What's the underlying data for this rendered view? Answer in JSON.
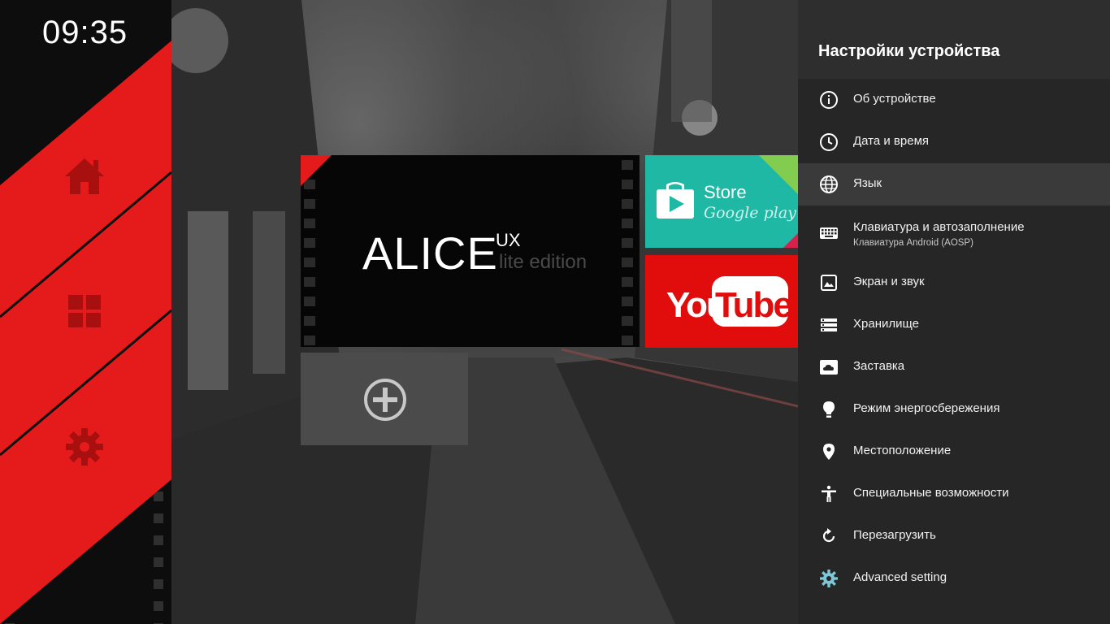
{
  "clock": "09:35",
  "sidebar": {
    "items": [
      {
        "name": "home-icon"
      },
      {
        "name": "apps-grid-icon"
      },
      {
        "name": "gear-icon"
      }
    ]
  },
  "tiles": {
    "alice": {
      "title": "ALICE",
      "superscript": "UX",
      "subtitle": "lite edition"
    },
    "store": {
      "title": "Store",
      "subtitle": "Google play"
    },
    "youtube": {
      "logo": "YouTube"
    },
    "add": {
      "icon": "plus-circle-icon"
    }
  },
  "settings": {
    "title": "Настройки устройства",
    "items": [
      {
        "label": "Об устройстве",
        "icon": "info-icon"
      },
      {
        "label": "Дата и время",
        "icon": "clock-icon"
      },
      {
        "label": "Язык",
        "icon": "globe-icon",
        "active": true
      },
      {
        "label": "Клавиатура и автозаполнение",
        "sublabel": "Клавиатура Android (AOSP)",
        "icon": "keyboard-icon"
      },
      {
        "label": "Экран и звук",
        "icon": "image-icon"
      },
      {
        "label": "Хранилище",
        "icon": "storage-icon"
      },
      {
        "label": "Заставка",
        "icon": "screensaver-icon"
      },
      {
        "label": "Режим энергосбережения",
        "icon": "lightbulb-icon"
      },
      {
        "label": "Местоположение",
        "icon": "location-icon"
      },
      {
        "label": "Специальные возможности",
        "icon": "accessibility-icon"
      },
      {
        "label": "Перезагрузить",
        "icon": "restart-icon"
      },
      {
        "label": "Advanced setting",
        "icon": "advanced-gear-icon"
      }
    ]
  },
  "colors": {
    "accent_red": "#e51a1a",
    "store_teal": "#1fb8a5",
    "youtube_red": "#e10d0d",
    "panel_bg": "#262626"
  }
}
